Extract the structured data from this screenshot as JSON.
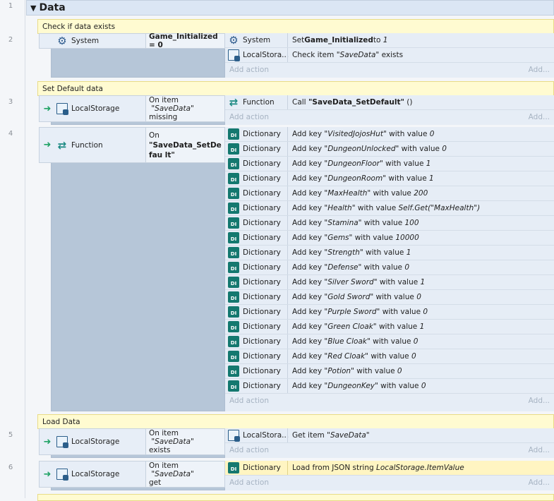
{
  "group": {
    "title": "Data"
  },
  "row_numbers": [
    "1",
    "2",
    "3",
    "4",
    "5",
    "6"
  ],
  "add_action": "Add action",
  "add_short": "Add...",
  "comments": {
    "c1": "Check if data exists",
    "c2": "Set Default data",
    "c3": "Load Data"
  },
  "events": {
    "e2": {
      "cond_object": "System",
      "cond_param": "Game_Initialized = 0",
      "actions": [
        {
          "object": "System",
          "pre": "Set ",
          "bold": "Game_Initialized",
          "mid": " to ",
          "ital": "1",
          "post": ""
        },
        {
          "object": "LocalStora...",
          "pre": "Check item ",
          "ital": "\"SaveData\"",
          "post": " exists"
        }
      ]
    },
    "e3": {
      "cond_object": "LocalStorage",
      "cond_param_pre": "On item ",
      "cond_param_ital": "\"SaveData\"",
      "cond_param_post": "missing",
      "actions": [
        {
          "object": "Function",
          "pre": "Call ",
          "bold": "\"SaveData_SetDefault\"",
          "post": " ()"
        }
      ]
    },
    "e4": {
      "cond_object": "Function",
      "cond_param_pre": "On",
      "cond_param_bold": "\"SaveData_SetDefau lt\"",
      "actions": [
        {
          "object": "Dictionary",
          "key": "\"VisitedJojosHut\"",
          "value": "0"
        },
        {
          "object": "Dictionary",
          "key": "\"DungeonUnlocked\"",
          "value": "0"
        },
        {
          "object": "Dictionary",
          "key": "\"DungeonFloor\"",
          "value": "1"
        },
        {
          "object": "Dictionary",
          "key": "\"DungeonRoom\"",
          "value": "1"
        },
        {
          "object": "Dictionary",
          "key": "\"MaxHealth\"",
          "value": "200"
        },
        {
          "object": "Dictionary",
          "key": "\"Health\"",
          "value": "Self.Get(\"MaxHealth\")"
        },
        {
          "object": "Dictionary",
          "key": "\"Stamina\"",
          "value": "100"
        },
        {
          "object": "Dictionary",
          "key": "\"Gems\"",
          "value": "10000"
        },
        {
          "object": "Dictionary",
          "key": "\"Strength\"",
          "value": "1"
        },
        {
          "object": "Dictionary",
          "key": "\"Defense\"",
          "value": "0"
        },
        {
          "object": "Dictionary",
          "key": "\"Silver Sword\"",
          "value": "1"
        },
        {
          "object": "Dictionary",
          "key": "\"Gold Sword\"",
          "value": "0"
        },
        {
          "object": "Dictionary",
          "key": "\"Purple Sword\"",
          "value": "0"
        },
        {
          "object": "Dictionary",
          "key": "\"Green Cloak\"",
          "value": "1"
        },
        {
          "object": "Dictionary",
          "key": "\"Blue Cloak\"",
          "value": "0"
        },
        {
          "object": "Dictionary",
          "key": "\"Red Cloak\"",
          "value": "0"
        },
        {
          "object": "Dictionary",
          "key": "\"Potion\"",
          "value": "0"
        },
        {
          "object": "Dictionary",
          "key": "\"DungeonKey\"",
          "value": "0"
        }
      ],
      "add_key_prefix": "Add key ",
      "with_value": " with value "
    },
    "e5": {
      "cond_object": "LocalStorage",
      "cond_param_pre": "On item ",
      "cond_param_ital": "\"SaveData\"",
      "cond_param_post": "exists",
      "actions": [
        {
          "object": "LocalStora...",
          "pre": "Get item ",
          "ital": "\"SaveData\"",
          "post": ""
        }
      ]
    },
    "e6": {
      "cond_object": "LocalStorage",
      "cond_param_pre": "On item ",
      "cond_param_ital": "\"SaveData\"",
      "cond_param_post": "get",
      "actions": [
        {
          "object": "Dictionary",
          "pre": "Load from JSON string ",
          "ital": "LocalStorage.ItemValue",
          "post": ""
        }
      ]
    }
  },
  "icons": {
    "system": "gear-icon",
    "localstorage": "document-icon",
    "function": "function-arrows-icon",
    "dictionary": "dictionary-icon",
    "trigger": "trigger-arrow-icon"
  }
}
